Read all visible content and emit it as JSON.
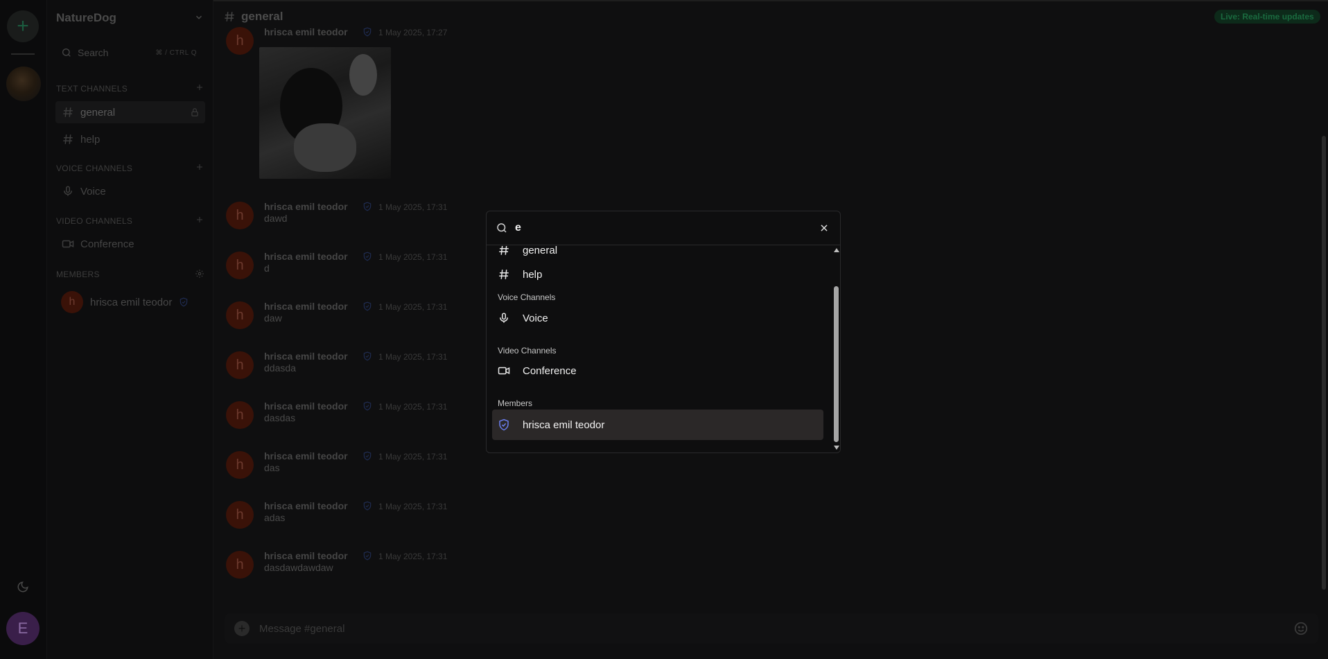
{
  "server": {
    "name": "NatureDog",
    "add_icon": "plus-icon",
    "avatar_icon": "server-avatar"
  },
  "user": {
    "initial": "E"
  },
  "sidebar": {
    "search_label": "Search",
    "search_hint": "⌘ / CTRL Q",
    "text_channels_label": "TEXT CHANNELS",
    "voice_channels_label": "VOICE CHANNELS",
    "video_channels_label": "VIDEO CHANNELS",
    "members_label": "MEMBERS",
    "text_channels": [
      {
        "name": "general",
        "active": true
      },
      {
        "name": "help",
        "active": false
      }
    ],
    "voice_channels": [
      {
        "name": "Voice"
      }
    ],
    "video_channels": [
      {
        "name": "Conference"
      }
    ],
    "members": [
      {
        "initial": "h",
        "name": "hrisca emil teodor"
      }
    ]
  },
  "chat": {
    "channel": "general",
    "live_badge": "Live: Real-time updates",
    "composer_placeholder": "Message #general",
    "messages": [
      {
        "initial": "h",
        "author": "hrisca emil teodor",
        "time": "1 May 2025, 17:27",
        "text": ""
      },
      {
        "initial": "h",
        "author": "hrisca emil teodor",
        "time": "1 May 2025, 17:31",
        "text": "dawd"
      },
      {
        "initial": "h",
        "author": "hrisca emil teodor",
        "time": "1 May 2025, 17:31",
        "text": "d"
      },
      {
        "initial": "h",
        "author": "hrisca emil teodor",
        "time": "1 May 2025, 17:31",
        "text": "daw"
      },
      {
        "initial": "h",
        "author": "hrisca emil teodor",
        "time": "1 May 2025, 17:31",
        "text": "ddasda"
      },
      {
        "initial": "h",
        "author": "hrisca emil teodor",
        "time": "1 May 2025, 17:31",
        "text": "dasdas"
      },
      {
        "initial": "h",
        "author": "hrisca emil teodor",
        "time": "1 May 2025, 17:31",
        "text": "das"
      },
      {
        "initial": "h",
        "author": "hrisca emil teodor",
        "time": "1 May 2025, 17:31",
        "text": "adas"
      },
      {
        "initial": "h",
        "author": "hrisca emil teodor",
        "time": "1 May 2025, 17:31",
        "text": "dasdawdawdaw"
      }
    ]
  },
  "quick_switcher": {
    "query": "e",
    "items": [
      {
        "kind": "text",
        "label": "general"
      },
      {
        "kind": "text",
        "label": "help"
      }
    ],
    "voice_heading": "Voice Channels",
    "voice_items": [
      {
        "label": "Voice"
      }
    ],
    "video_heading": "Video Channels",
    "video_items": [
      {
        "label": "Conference"
      }
    ],
    "members_heading": "Members",
    "member_items": [
      {
        "label": "hrisca emil teodor",
        "selected": true
      }
    ]
  },
  "colors": {
    "accent_green": "#1a6a3f",
    "shield_blue": "#6b7ef0",
    "avatar_red": "#3a1208",
    "user_purple": "#3a1f4a"
  }
}
